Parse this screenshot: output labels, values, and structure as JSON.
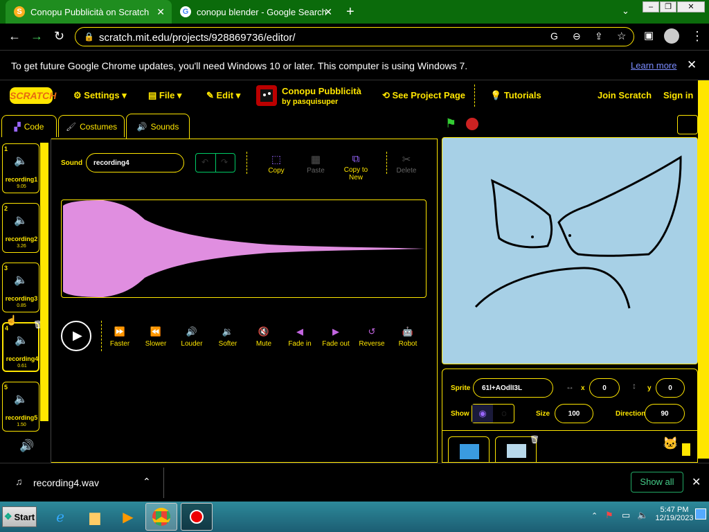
{
  "browser": {
    "tabs": [
      {
        "title": "Conopu Pubblicità on Scratch",
        "active": true
      },
      {
        "title": "conopu blender - Google Search",
        "active": false
      }
    ],
    "url": "scratch.mit.edu/projects/928869736/editor/",
    "infobar": {
      "message": "To get future Google Chrome updates, you'll need Windows 10 or later. This computer is using Windows 7.",
      "link": "Learn more"
    }
  },
  "scratch": {
    "logo": "SCRATCH",
    "menu": {
      "settings": "Settings",
      "file": "File",
      "edit": "Edit",
      "project_title": "Conopu Pubblicità",
      "project_by": "by pasquisuper",
      "see_project": "See Project Page",
      "tutorials": "Tutorials",
      "join": "Join Scratch",
      "signin": "Sign in"
    },
    "tabs": {
      "code": "Code",
      "costumes": "Costumes",
      "sounds": "Sounds"
    },
    "sounds": [
      {
        "num": "1",
        "name": "recording1",
        "dur": "9.05"
      },
      {
        "num": "2",
        "name": "recording2",
        "dur": "3.26"
      },
      {
        "num": "3",
        "name": "recording3",
        "dur": "0.85"
      },
      {
        "num": "4",
        "name": "recording4",
        "dur": "0.61"
      },
      {
        "num": "5",
        "name": "recording5",
        "dur": "1.50"
      }
    ],
    "editor": {
      "sound_label": "Sound",
      "sound_name": "recording4",
      "tools": {
        "copy": "Copy",
        "paste": "Paste",
        "copy_to_new": "Copy to New",
        "delete": "Delete"
      },
      "effects": [
        "Faster",
        "Slower",
        "Louder",
        "Softer",
        "Mute",
        "Fade in",
        "Fade out",
        "Reverse",
        "Robot"
      ]
    },
    "sprite": {
      "label": "Sprite",
      "name": "61l+AOdlI3L",
      "x_label": "x",
      "x": "0",
      "y_label": "y",
      "y": "0",
      "show_label": "Show",
      "size_label": "Size",
      "size": "100",
      "direction_label": "Direction",
      "direction": "90"
    }
  },
  "downloads": {
    "file": "recording4.wav",
    "show_all": "Show all"
  },
  "taskbar": {
    "start": "Start",
    "time": "5:47 PM",
    "date": "12/19/2023"
  },
  "colors": {
    "accent": "#ffe600",
    "wave": "#e08ee0",
    "purple": "#9966ff"
  }
}
